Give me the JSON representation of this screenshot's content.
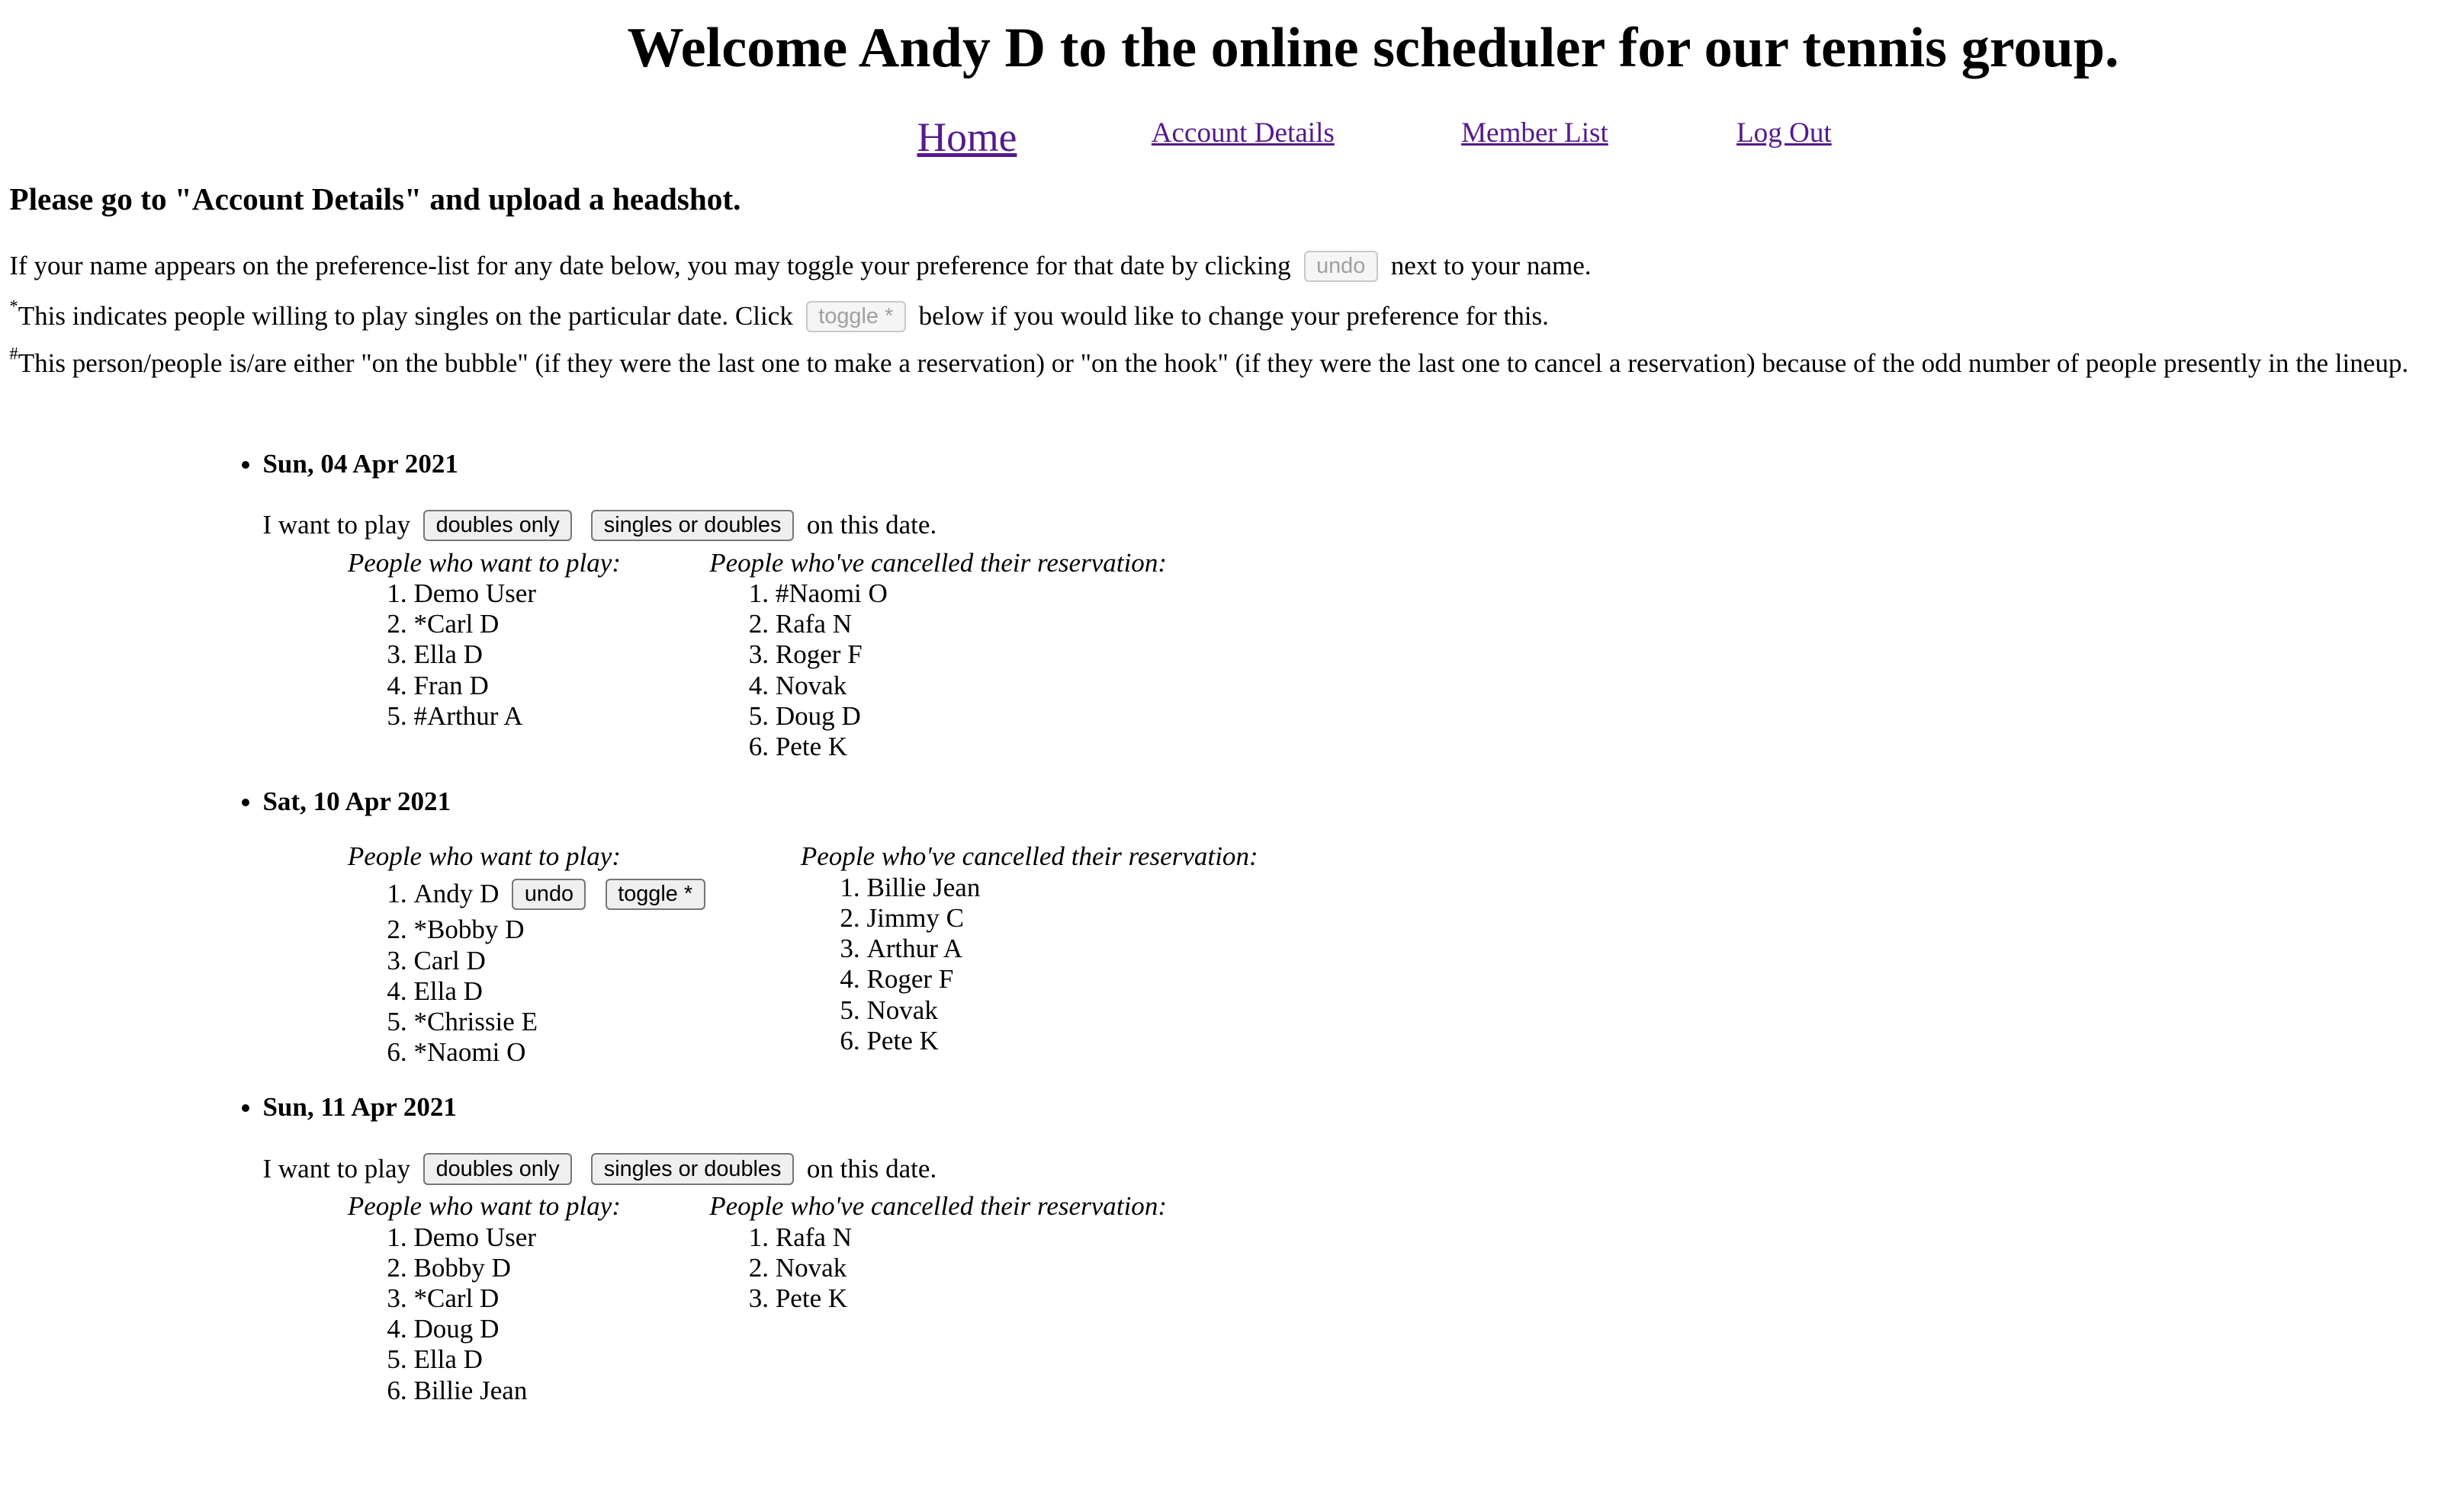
{
  "header": {
    "title": "Welcome Andy D to the online scheduler for our tennis group."
  },
  "nav": {
    "home": "Home",
    "account_details": "Account Details",
    "member_list": "Member List",
    "log_out": "Log Out"
  },
  "notice": "Please go to \"Account Details\" and upload a headshot.",
  "instructions": {
    "line1_pre": "If your name appears on the preference-list for any date below, you may toggle your preference for that date by clicking",
    "line1_button": "undo",
    "line1_post": "next to your name.",
    "line2_mark": "*",
    "line2_pre": "This indicates people willing to play singles on the particular date. Click",
    "line2_button": "toggle *",
    "line2_post": "below if you would like to change your preference for this.",
    "line3_mark": "#",
    "line3_text": "This person/people is/are either \"on the bubble\" (if they were the last one to make a reservation) or \"on the hook\" (if they were the last one to cancel a reservation) because of the odd number of people presently in the lineup."
  },
  "labels": {
    "want_pre": "I want to play",
    "doubles_only": "doubles only",
    "singles_or_doubles": "singles or doubles",
    "want_post": "on this date.",
    "want_header": "People who want to play:",
    "cancel_header": "People who've cancelled their reservation:",
    "undo": "undo",
    "toggle": "toggle *"
  },
  "dates": [
    {
      "date": "Sun, 04 Apr 2021",
      "players": [
        "Demo User",
        "*Carl D",
        "Ella D",
        "Fran D",
        "#Arthur A"
      ],
      "cancelled": [
        "#Naomi O",
        "Rafa N",
        "Roger F",
        "Novak",
        "Doug D",
        "Pete K"
      ]
    },
    {
      "date": "Sat, 10 Apr 2021",
      "players": [
        "Andy D",
        "*Bobby D",
        "Carl D",
        "Ella D",
        "*Chrissie E",
        "*Naomi O"
      ],
      "cancelled": [
        "Billie Jean",
        "Jimmy C",
        "Arthur A",
        "Roger F",
        "Novak",
        "Pete K"
      ]
    },
    {
      "date": "Sun, 11 Apr 2021",
      "players": [
        "Demo User",
        "Bobby D",
        "*Carl D",
        "Doug D",
        "Ella D",
        "Billie Jean"
      ],
      "cancelled": [
        "Rafa N",
        "Novak",
        "Pete K"
      ]
    }
  ]
}
